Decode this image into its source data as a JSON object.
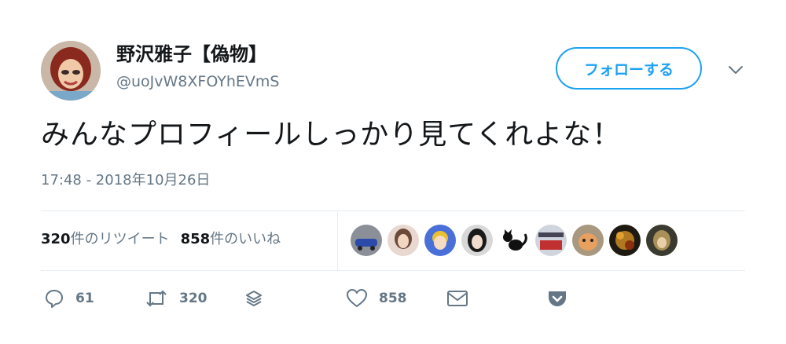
{
  "user": {
    "display_name": "野沢雅子【偽物】",
    "handle": "@uoJvW8XFOYhEVmS"
  },
  "follow_button": {
    "label": "フォローする"
  },
  "tweet": {
    "text": "みんなプロフィールしっかり見てくれよな！",
    "timestamp": "17:48 - 2018年10月26日"
  },
  "stats": {
    "retweets_count": "320",
    "retweets_label": "件のリツイート",
    "likes_count": "858",
    "likes_label": "件のいいね"
  },
  "actions": {
    "reply_count": "61",
    "retweet_count": "320",
    "like_count": "858"
  },
  "colors": {
    "accent": "#1da1f2",
    "secondary_text": "#657786",
    "divider": "#e6ecf0"
  },
  "icons": [
    "chevron-down-icon",
    "reply-icon",
    "retweet-icon",
    "stack-icon",
    "heart-icon",
    "envelope-icon",
    "pocket-icon"
  ]
}
